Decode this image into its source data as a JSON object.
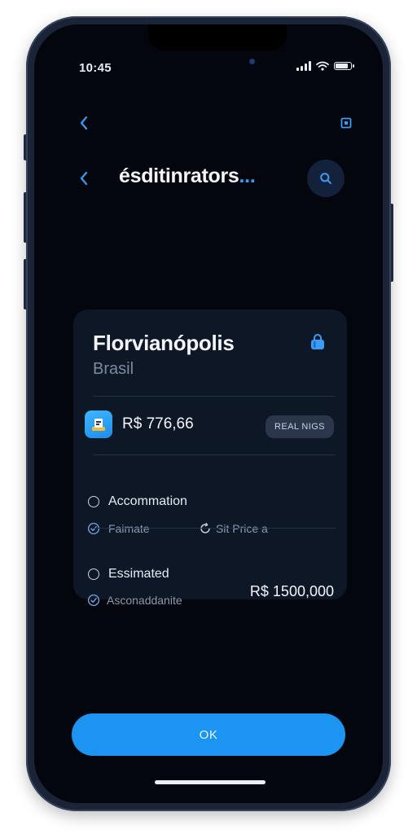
{
  "status_bar": {
    "time": "10:45"
  },
  "header": {
    "title": "ésditinrators",
    "title_ellipsis": "..."
  },
  "card": {
    "city": "Florvianópolis",
    "country": "Brasil",
    "price": "R$ 776,66",
    "pill_label": "REAL NIGS",
    "row1": {
      "label": "Accommation",
      "option_a": "Faimate",
      "option_b": "Sit Price a"
    },
    "row2": {
      "label": "Essimated",
      "option": "Asconaddanite",
      "total": "R$ 1500,000"
    }
  },
  "ok_button_label": "OK",
  "colors": {
    "accent": "#1c95f2",
    "screen_bg": "#03070d",
    "card_bg": "#0e1726",
    "text_primary": "#f4f6fa",
    "text_muted": "#7d8aa2"
  },
  "icons": {
    "back": "chevron-left-icon",
    "square": "square-icon",
    "search": "search-icon",
    "bag": "shopping-bag-icon",
    "app": "app-icon",
    "check": "check-circle-icon",
    "refresh": "refresh-icon"
  }
}
